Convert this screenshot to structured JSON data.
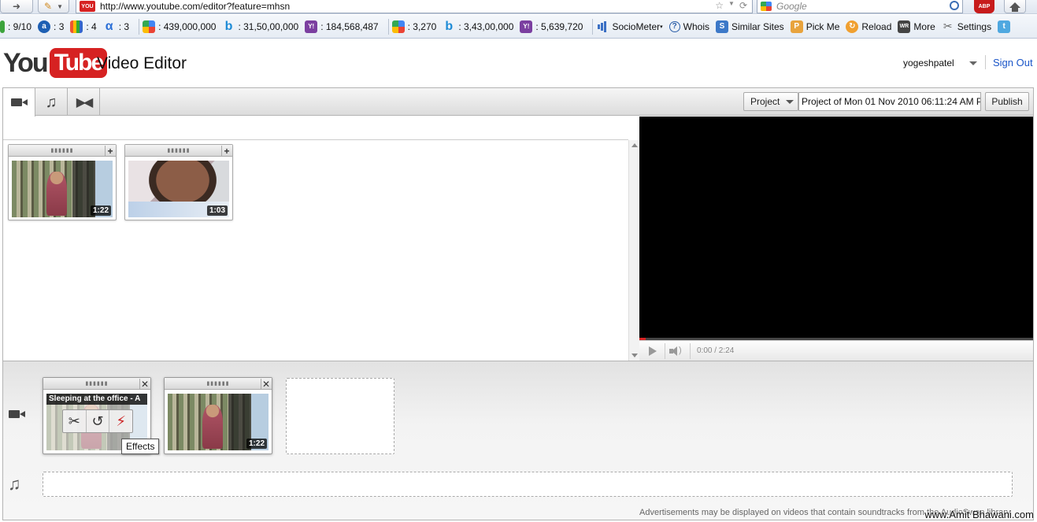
{
  "browser": {
    "url": "http://www.youtube.com/editor?feature=mhsn",
    "search_placeholder": "Google",
    "toolbar": [
      {
        "icon": "pagerank-icon",
        "value": ": 9/10"
      },
      {
        "icon": "alexa-icon",
        "value": ": 3"
      },
      {
        "icon": "compete-icon",
        "value": ": 4"
      },
      {
        "icon": "alpha-icon",
        "value": ": 3"
      },
      {
        "icon": "google-index-icon",
        "value": ": 439,000,000"
      },
      {
        "icon": "bing-index-icon",
        "value": ": 31,50,00,000"
      },
      {
        "icon": "yahoo-index-icon",
        "value": ": 184,568,487"
      },
      {
        "icon": "google-links-icon",
        "value": ": 3,270"
      },
      {
        "icon": "bing-links-icon",
        "value": ": 3,43,00,000"
      },
      {
        "icon": "yahoo-links-icon",
        "value": ": 5,639,720"
      },
      {
        "icon": "sociometer-icon",
        "value": "SocioMeter"
      },
      {
        "icon": "whois-icon",
        "value": "Whois"
      },
      {
        "icon": "similar-sites-icon",
        "value": "Similar Sites"
      },
      {
        "icon": "pick-me-icon",
        "value": "Pick Me"
      },
      {
        "icon": "reload-icon",
        "value": "Reload"
      },
      {
        "icon": "more-icon",
        "value": "More"
      },
      {
        "icon": "settings-icon",
        "value": "Settings"
      }
    ]
  },
  "header": {
    "logo_you": "You",
    "logo_tube": "Tube",
    "title": "Video Editor",
    "username": "yogeshpatel",
    "sign_out": "Sign Out"
  },
  "editor": {
    "project_label": "Project",
    "project_name": "Project of Mon 01 Nov 2010 06:11:24 AM P",
    "publish_label": "Publish",
    "library_clips": [
      {
        "duration": "1:22"
      },
      {
        "duration": "1:03"
      }
    ],
    "player": {
      "time": "0:00 / 2:24",
      "progress": 0.0
    },
    "timeline": {
      "clip1_caption": "Sleeping at the office - A",
      "clip2_duration": "1:22",
      "tooltip": "Effects",
      "ad_notice": "Advertisements may be displayed on videos that contain soundtracks from the AudioSwap library"
    }
  },
  "watermark": "www.Amit Bhawani.com"
}
